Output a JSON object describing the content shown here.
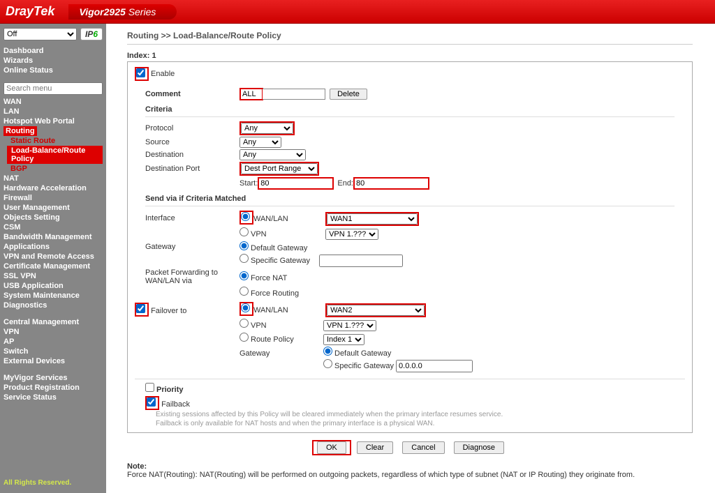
{
  "header": {
    "brand": "DrayTek",
    "series": "Vigor",
    "model": "2925",
    "series_label": "Series"
  },
  "sidebar": {
    "mode_options": [
      "Off"
    ],
    "search_placeholder": "Search menu",
    "top_items": [
      "Dashboard",
      "Wizards",
      "Online Status"
    ],
    "main_items_pre": [
      "WAN",
      "LAN",
      "Hotspot Web Portal"
    ],
    "routing_label": "Routing",
    "routing_sub": [
      "Static Route",
      "Load-Balance/Route Policy",
      "BGP"
    ],
    "main_items_post": [
      "NAT",
      "Hardware Acceleration",
      "Firewall",
      "User Management",
      "Objects Setting",
      "CSM",
      "Bandwidth Management",
      "Applications",
      "VPN and Remote Access",
      "Certificate Management",
      "SSL VPN",
      "USB Application",
      "System Maintenance",
      "Diagnostics"
    ],
    "central_mgmt": [
      "Central Management",
      "VPN",
      "AP",
      "Switch",
      "External Devices"
    ],
    "services": [
      "MyVigor Services",
      "Product Registration",
      "Service Status"
    ],
    "footer": "All Rights Reserved."
  },
  "breadcrumb": "Routing >> Load-Balance/Route Policy",
  "index_label": "Index: 1",
  "enable_label": "Enable",
  "comment": {
    "label": "Comment",
    "value": "ALL",
    "delete": "Delete"
  },
  "criteria": {
    "header": "Criteria",
    "protocol": {
      "label": "Protocol",
      "value": "Any"
    },
    "source": {
      "label": "Source",
      "value": "Any"
    },
    "destination": {
      "label": "Destination",
      "value": "Any"
    },
    "dest_port": {
      "label": "Destination Port",
      "value": "Dest Port Range",
      "start_label": "Start:",
      "start_value": "80",
      "end_label": "End:",
      "end_value": "80"
    }
  },
  "send": {
    "header": "Send via if Criteria Matched",
    "interface": {
      "label": "Interface",
      "wanlan": "WAN/LAN",
      "wan_sel": "WAN1",
      "vpn": "VPN",
      "vpn_sel": "VPN 1.???"
    },
    "gateway": {
      "label": "Gateway",
      "default": "Default Gateway",
      "specific": "Specific Gateway"
    },
    "packet_fwd": {
      "label": "Packet Forwarding to WAN/LAN via",
      "force_nat": "Force NAT",
      "force_routing": "Force Routing"
    },
    "failover": {
      "label": "Failover to",
      "wanlan": "WAN/LAN",
      "wan_sel": "WAN2",
      "vpn": "VPN",
      "vpn_sel": "VPN 1.???",
      "route_policy": "Route Policy",
      "rp_sel": "Index 1",
      "gateway": "Gateway",
      "default": "Default Gateway",
      "specific": "Specific Gateway",
      "specific_val": "0.0.0.0"
    }
  },
  "priority_label": "Priority",
  "failback": {
    "label": "Failback",
    "note1": "Existing sessions affected by this Policy will be cleared immediately when the primary interface resumes service.",
    "note2": "Failback is only available for NAT hosts and when the primary interface is a physical WAN."
  },
  "buttons": {
    "ok": "OK",
    "clear": "Clear",
    "cancel": "Cancel",
    "diagnose": "Diagnose"
  },
  "note": {
    "header": "Note:",
    "body": "Force NAT(Routing): NAT(Routing) will be performed on outgoing packets, regardless of which type of subnet (NAT or IP Routing) they originate from."
  }
}
